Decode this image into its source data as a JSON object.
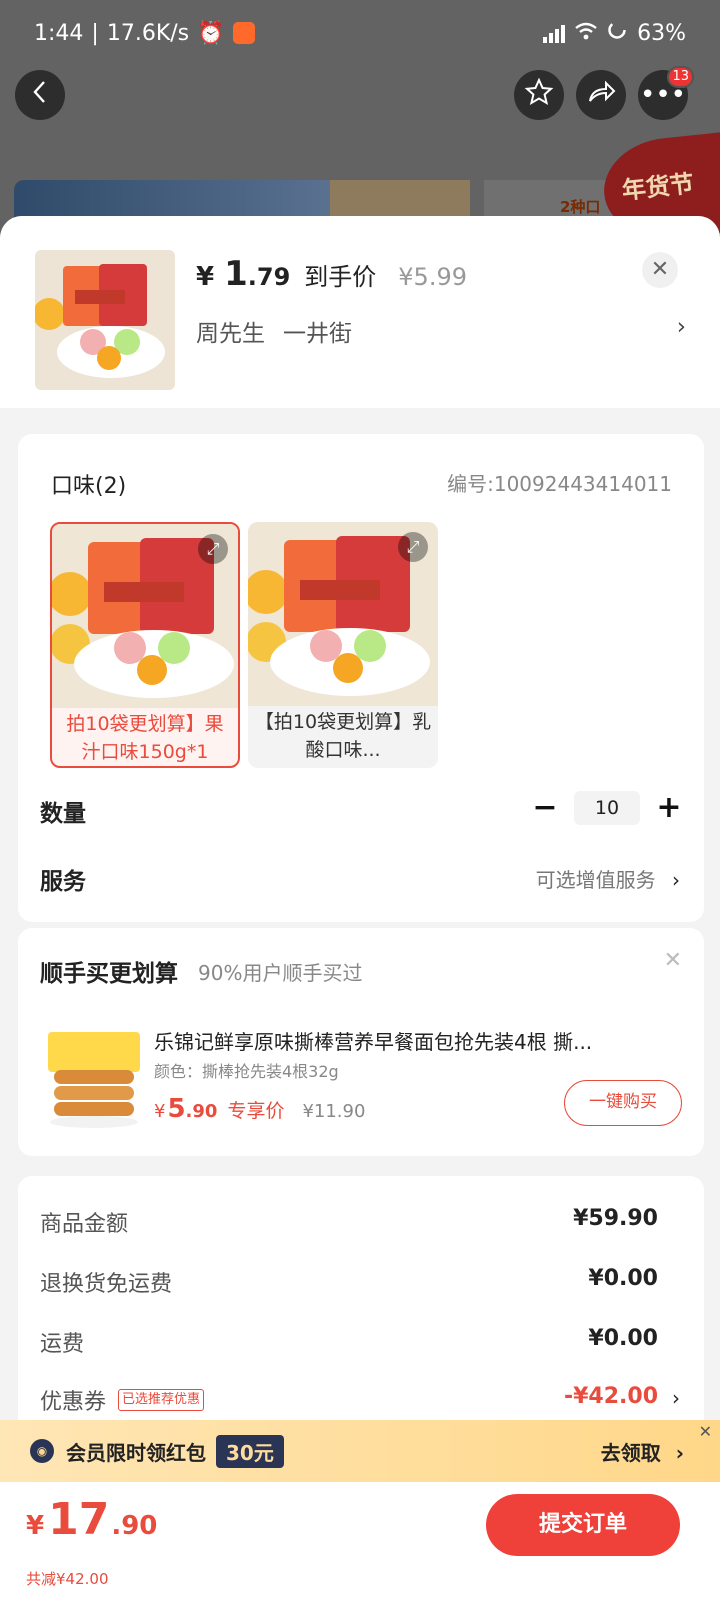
{
  "status_bar": {
    "time": "1:44",
    "speed": "17.6K/s",
    "battery": "63%"
  },
  "nav": {
    "more_badge": "13"
  },
  "background": {
    "banner_text": "年货节",
    "small_text": "2种口"
  },
  "sheet": {
    "price_symbol": "¥",
    "price_int": "1",
    "price_dec": ".79",
    "price_label": "到手价",
    "original_price": "¥5.99",
    "address_name": "周先生",
    "address_street": "一井街"
  },
  "flavor": {
    "title": "口味(2)",
    "code": "编号:10092443414011",
    "options": [
      {
        "label": "拍10袋更划算】果汁口味150g*1",
        "selected": true
      },
      {
        "label": "【拍10袋更划算】乳酸口味...",
        "selected": false
      }
    ]
  },
  "quantity": {
    "label": "数量",
    "value": "10"
  },
  "service": {
    "label": "服务",
    "value": "可选增值服务"
  },
  "upsell": {
    "title": "顺手买更划算",
    "subtitle": "90%用户顺手买过",
    "product_name": "乐锦记鲜享原味撕棒营养早餐面包抢先装4根 撕...",
    "product_color": "颜色：撕棒抢先装4根32g",
    "price_symbol": "¥",
    "price_int": "5",
    "price_dec": ".90",
    "price_tag": "专享价",
    "original_price": "¥11.90",
    "buy_button": "一键购买"
  },
  "summary": {
    "items": [
      {
        "label": "商品金额",
        "value": "¥59.90"
      },
      {
        "label": "退换货免运费",
        "value": "¥0.00"
      },
      {
        "label": "运费",
        "value": "¥0.00"
      },
      {
        "label": "优惠券",
        "tag": "已选推荐优惠",
        "value": "-¥42.00"
      }
    ]
  },
  "member_banner": {
    "text": "会员限时领红包",
    "amount": "30元",
    "action": "去领取"
  },
  "bottom": {
    "total_symbol": "¥",
    "total_int": "17",
    "total_dec": ".90",
    "saved": "共减¥42.00",
    "submit": "提交订单"
  },
  "colors": {
    "accent": "#e94b3c",
    "submit_bg": "#f0403a",
    "banner_gold": "#ffd789",
    "member_navy": "#2a3555"
  }
}
